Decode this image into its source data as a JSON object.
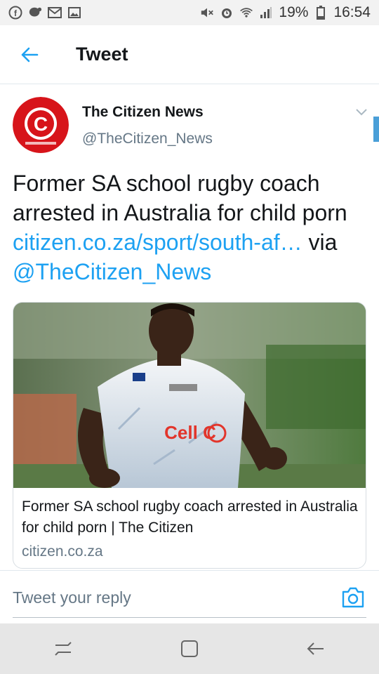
{
  "status_bar": {
    "left_icons": [
      "facebook-icon",
      "messenger-icon",
      "gmail-icon",
      "gallery-icon"
    ],
    "right_icons": [
      "mute-icon",
      "alarm-icon",
      "wifi-icon",
      "signal-icon"
    ],
    "battery": "19%",
    "time": "16:54"
  },
  "header": {
    "back_icon": "arrow-left-icon",
    "title": "Tweet"
  },
  "tweet": {
    "author_name": "The Citizen News",
    "author_handle": "@TheCitizen_News",
    "avatar_letter": "C",
    "avatar_color": "#d7141a",
    "text_main": "Former SA school rugby coach arrested in Australia for child porn",
    "link_text": "citizen.co.za/sport/south-af…",
    "via_text": " via",
    "mention": "@TheCitizen_News",
    "link_color": "#1da1f2"
  },
  "card": {
    "title": "Former SA school rugby coach arrested in Australia for child porn | The Citizen",
    "domain": "citizen.co.za",
    "image_desc_icon": "rugby-player-photo",
    "jersey_sponsor": "Cell C"
  },
  "reply": {
    "placeholder": "Tweet your reply",
    "camera_icon": "camera-icon"
  },
  "nav_bar": {
    "icons": [
      "recents-icon",
      "home-icon",
      "back-icon"
    ]
  }
}
